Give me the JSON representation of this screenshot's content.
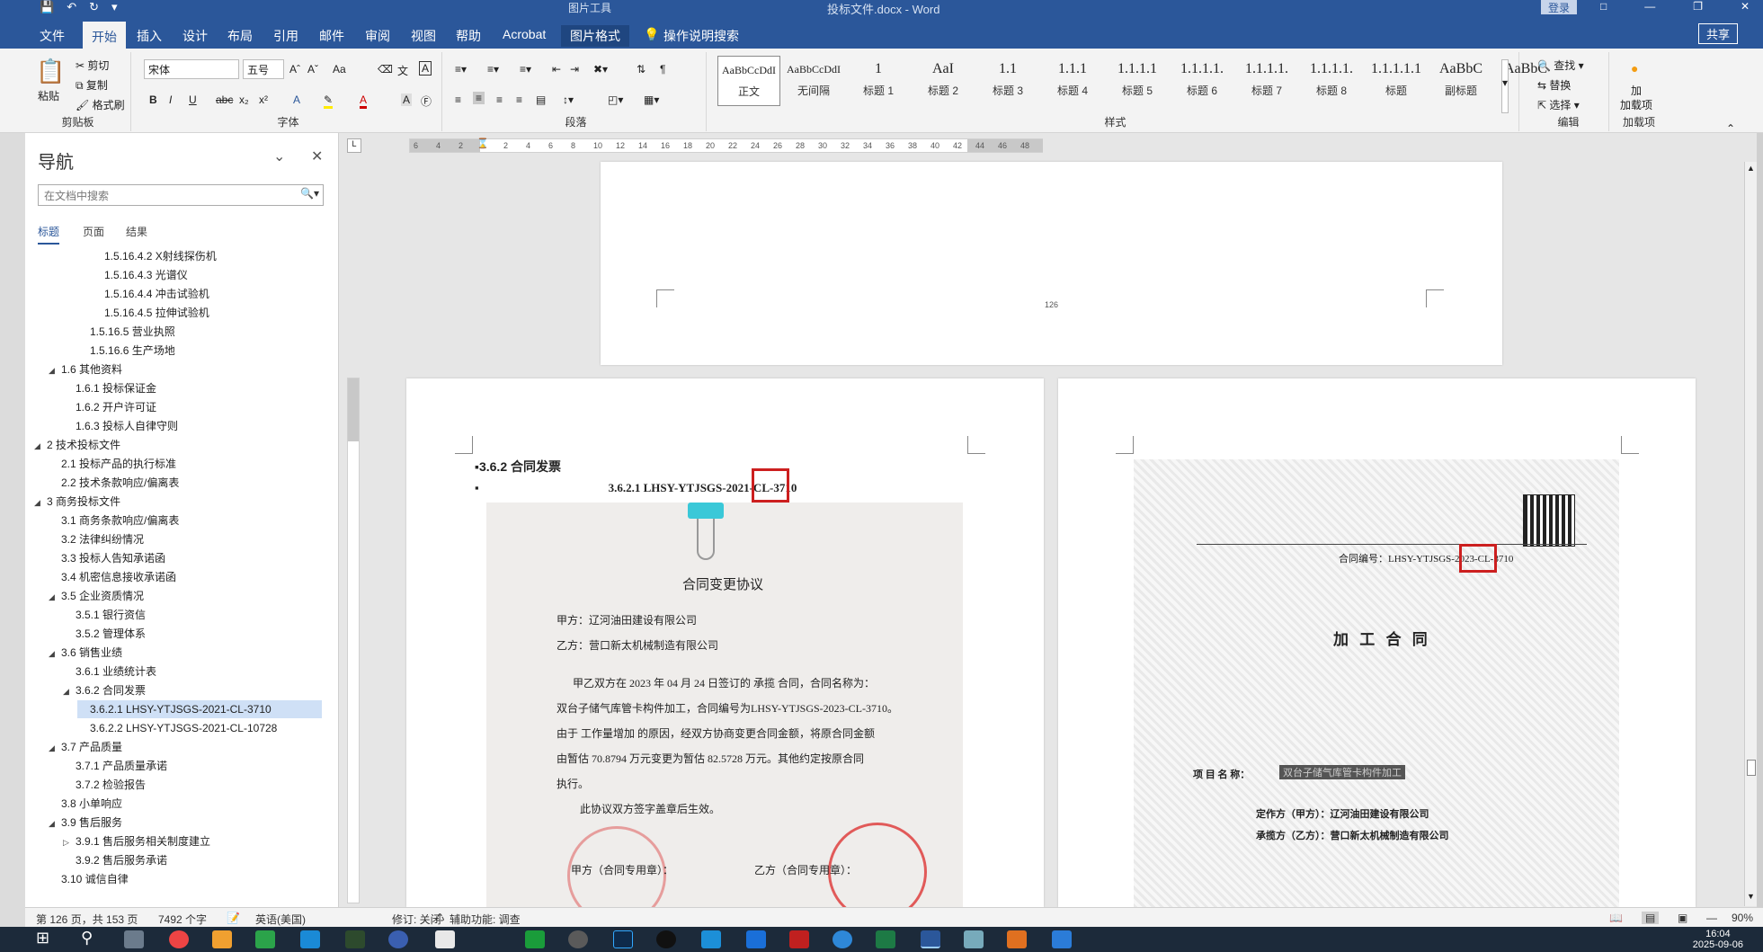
{
  "window": {
    "doc_title": "投标文件.docx - Word",
    "context_tool": "图片工具",
    "login": "登录",
    "share": "共享"
  },
  "tabs": [
    "文件",
    "开始",
    "插入",
    "设计",
    "布局",
    "引用",
    "邮件",
    "审阅",
    "视图",
    "帮助",
    "Acrobat",
    "图片格式",
    "操作说明搜索"
  ],
  "ribbon": {
    "clipboard": {
      "paste": "粘贴",
      "cut": "剪切",
      "copy": "复制",
      "format_painter": "格式刷",
      "label": "剪贴板"
    },
    "font": {
      "name": "宋体",
      "size": "五号",
      "label": "字体",
      "bold": "B",
      "italic": "I",
      "underline": "U",
      "strike": "abc",
      "sub": "x₂",
      "sup": "x²"
    },
    "paragraph": {
      "label": "段落"
    },
    "styles": {
      "label": "样式",
      "items": [
        {
          "prev": "AaBbCcDdI",
          "name": "正文"
        },
        {
          "prev": "AaBbCcDdI",
          "name": "无间隔"
        },
        {
          "prev": "1",
          "name": "标题 1"
        },
        {
          "prev": "AaI",
          "name": "标题 2"
        },
        {
          "prev": "1.1",
          "name": "标题 3"
        },
        {
          "prev": "1.1.1",
          "name": "标题 4"
        },
        {
          "prev": "1.1.1.1",
          "name": "标题 5"
        },
        {
          "prev": "1.1.1.1.",
          "name": "标题 6"
        },
        {
          "prev": "1.1.1.1.",
          "name": "标题 7"
        },
        {
          "prev": "1.1.1.1.",
          "name": "标题 8"
        },
        {
          "prev": "1.1.1.1.1",
          "name": "标题"
        },
        {
          "prev": "AaBbC",
          "name": "副标题"
        },
        {
          "prev": "AaBbC",
          "name": ""
        }
      ]
    },
    "editing": {
      "find": "查找",
      "replace": "替换",
      "select": "选择",
      "label": "编辑"
    },
    "addins": {
      "load": "加载项",
      "label": "加载项",
      "sub": "加"
    }
  },
  "nav": {
    "title": "导航",
    "search_placeholder": "在文档中搜索",
    "tabs": [
      "标题",
      "页面",
      "结果"
    ],
    "items": [
      {
        "text": "1.5.16.4.2 X射线探伤机",
        "level": 4,
        "tri": ""
      },
      {
        "text": "1.5.16.4.3 光谱仪",
        "level": 4,
        "tri": ""
      },
      {
        "text": "1.5.16.4.4 冲击试验机",
        "level": 4,
        "tri": ""
      },
      {
        "text": "1.5.16.4.5 拉伸试验机",
        "level": 4,
        "tri": ""
      },
      {
        "text": "1.5.16.5 营业执照",
        "level": 3,
        "tri": ""
      },
      {
        "text": "1.5.16.6 生产场地",
        "level": 3,
        "tri": ""
      },
      {
        "text": "1.6 其他资料",
        "level": 1,
        "tri": "◢"
      },
      {
        "text": "1.6.1 投标保证金",
        "level": 2,
        "tri": ""
      },
      {
        "text": "1.6.2 开户许可证",
        "level": 2,
        "tri": ""
      },
      {
        "text": "1.6.3 投标人自律守则",
        "level": 2,
        "tri": ""
      },
      {
        "text": "2 技术投标文件",
        "level": 0,
        "tri": "◢"
      },
      {
        "text": "2.1 投标产品的执行标准",
        "level": 1,
        "tri": ""
      },
      {
        "text": "2.2 技术条款响应/偏离表",
        "level": 1,
        "tri": ""
      },
      {
        "text": "3 商务投标文件",
        "level": 0,
        "tri": "◢"
      },
      {
        "text": "3.1 商务条款响应/偏离表",
        "level": 1,
        "tri": ""
      },
      {
        "text": "3.2 法律纠纷情况",
        "level": 1,
        "tri": ""
      },
      {
        "text": "3.3 投标人告知承诺函",
        "level": 1,
        "tri": ""
      },
      {
        "text": "3.4 机密信息接收承诺函",
        "level": 1,
        "tri": ""
      },
      {
        "text": "3.5 企业资质情况",
        "level": 1,
        "tri": "◢"
      },
      {
        "text": "3.5.1 银行资信",
        "level": 2,
        "tri": ""
      },
      {
        "text": "3.5.2 管理体系",
        "level": 2,
        "tri": ""
      },
      {
        "text": "3.6 销售业绩",
        "level": 1,
        "tri": "◢"
      },
      {
        "text": "3.6.1 业绩统计表",
        "level": 2,
        "tri": ""
      },
      {
        "text": "3.6.2 合同发票",
        "level": 2,
        "tri": "◢"
      },
      {
        "text": "3.6.2.1 LHSY-YTJSGS-2021-CL-3710",
        "level": 3,
        "tri": "",
        "selected": true
      },
      {
        "text": "3.6.2.2 LHSY-YTJSGS-2021-CL-10728",
        "level": 3,
        "tri": ""
      },
      {
        "text": "3.7 产品质量",
        "level": 1,
        "tri": "◢"
      },
      {
        "text": "3.7.1 产品质量承诺",
        "level": 2,
        "tri": ""
      },
      {
        "text": "3.7.2 检验报告",
        "level": 2,
        "tri": ""
      },
      {
        "text": "3.8 小单响应",
        "level": 1,
        "tri": ""
      },
      {
        "text": "3.9 售后服务",
        "level": 1,
        "tri": "◢"
      },
      {
        "text": "3.9.1 售后服务相关制度建立",
        "level": 2,
        "tri": "▷"
      },
      {
        "text": "3.9.2 售后服务承诺",
        "level": 2,
        "tri": ""
      },
      {
        "text": "3.10 诚信自律",
        "level": 1,
        "tri": ""
      }
    ]
  },
  "ruler": {
    "ticks": [
      "6",
      "4",
      "2",
      "",
      "2",
      "4",
      "6",
      "8",
      "10",
      "12",
      "14",
      "16",
      "18",
      "20",
      "22",
      "24",
      "26",
      "28",
      "30",
      "32",
      "34",
      "36",
      "38",
      "40",
      "42",
      "44",
      "46",
      "48"
    ]
  },
  "document": {
    "page_number": "126",
    "heading": "3.6.2 合同发票",
    "subheading": "3.6.2.1    LHSY-YTJSGS-2021-CL-3710",
    "amendment": {
      "title": "合同变更协议",
      "party_a": "甲方：辽河油田建设有限公司",
      "party_b": "乙方：营口新太机械制造有限公司",
      "body1": "甲乙双方在 2023 年 04 月 24 日签订的 承揽 合同，合同名称为：",
      "body2": "双台子储气库管卡构件加工，合同编号为LHSY-YTJSGS-2023-CL-3710。",
      "body3": "由于 工作量增加 的原因，经双方协商变更合同金额，将原合同金额",
      "body4": "由暂估 70.8794 万元变更为暂估 82.5728 万元。其他约定按原合同",
      "body5": "执行。",
      "body6": "此协议双方签字盖章后生效。",
      "sign_a": "甲方（合同专用章）：",
      "sign_b": "乙方（合同专用章）："
    },
    "contract": {
      "number": "合同编号：LHSY-YTJSGS-2023-CL-3710",
      "title": "加 工 合 同",
      "project": "项 目 名 称：",
      "project_val": "双台子储气库管卡构件加工",
      "party_a": "定作方（甲方）：辽河油田建设有限公司",
      "party_b": "承揽方（乙方）：营口新太机械制造有限公司"
    }
  },
  "status": {
    "page": "第 126 页，共 153 页",
    "words": "7492 个字",
    "lang": "英语(美国)",
    "track": "修订: 关闭",
    "access": "辅助功能: 调查",
    "zoom": "90%"
  },
  "clock": {
    "time": "16:04",
    "date": "2025-09-06"
  }
}
